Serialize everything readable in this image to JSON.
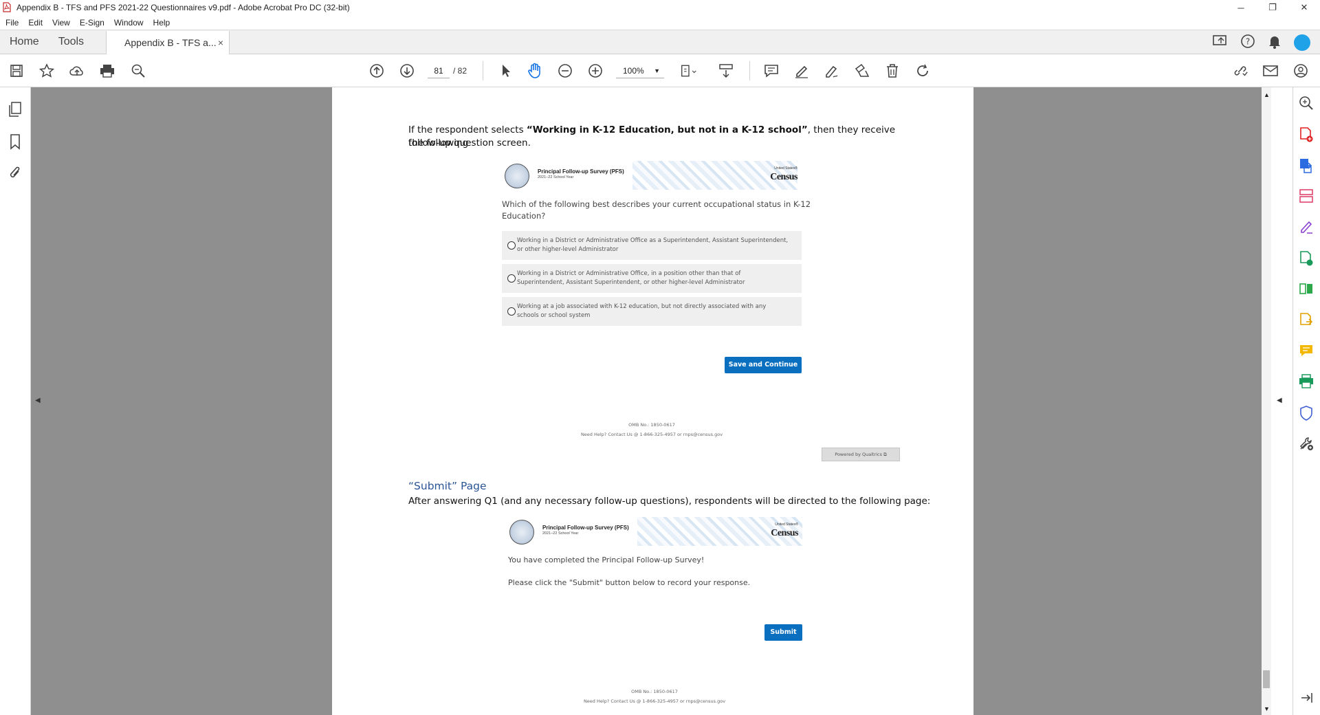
{
  "window": {
    "title": "Appendix B - TFS and PFS 2021-22 Questionnaires v9.pdf - Adobe Acrobat Pro DC (32-bit)",
    "minimize": "─",
    "maximize": "❐",
    "close": "✕"
  },
  "menu": [
    "File",
    "Edit",
    "View",
    "E-Sign",
    "Window",
    "Help"
  ],
  "tabs": {
    "home": "Home",
    "tools": "Tools",
    "document": "Appendix B - TFS a...",
    "close": "×"
  },
  "toolbar": {
    "current_page": "81",
    "page_total": "/  82",
    "zoom": "100%",
    "zoom_arrow": "▼"
  },
  "document": {
    "intro_text_1": "If the respondent selects ",
    "intro_bold": "“Working in K-12 Education, but not in a K-12 school”",
    "intro_text_2": ", then they receive the following",
    "intro_line2": "follow-up question screen.",
    "survey_title": "Principal Follow-up Survey (PFS)",
    "survey_year": "2021–22 School Year",
    "census_small": "United States®",
    "census_big": "Census",
    "census_bureau": "Bureau",
    "question_line1": "Which of the following best describes your current occupational status in K-12",
    "question_line2": "Education?",
    "options": [
      {
        "line1": "Working in a District or Administrative Office as a Superintendent, Assistant Superintendent,",
        "line2": "or other higher-level Administrator"
      },
      {
        "line1": "Working in a District or Administrative Office, in a position other than that of",
        "line2": "Superintendent, Assistant Superintendent, or other higher-level Administrator"
      },
      {
        "line1": "Working at a job associated with K-12 education, but not directly associated with any",
        "line2": "schools or school system"
      }
    ],
    "save_continue": "Save and Continue",
    "omb": "OMB No.: 1850-0617",
    "help": "Need Help? Contact Us @ 1-866-325-4957 or rnps@census.gov",
    "powered": "Powered by Qualtrics ⧉",
    "submit_heading": "“Submit” Page",
    "submit_intro": "After answering Q1 (and any necessary follow-up questions), respondents will be directed to the following page:",
    "complete_line1": "You have completed the Principal Follow-up Survey!",
    "complete_line2": "Please click the \"Submit\" button below to record your response.",
    "submit_button": "Submit",
    "omb2": "OMB No.: 1850-0617",
    "help2": "Need Help? Contact Us @ 1-866-325-4957 or rnps@census.gov"
  },
  "colors": {
    "accent_blue": "#0a6fbf",
    "heading_blue": "#2a5595",
    "canvas_gray": "#8f8f8f"
  }
}
